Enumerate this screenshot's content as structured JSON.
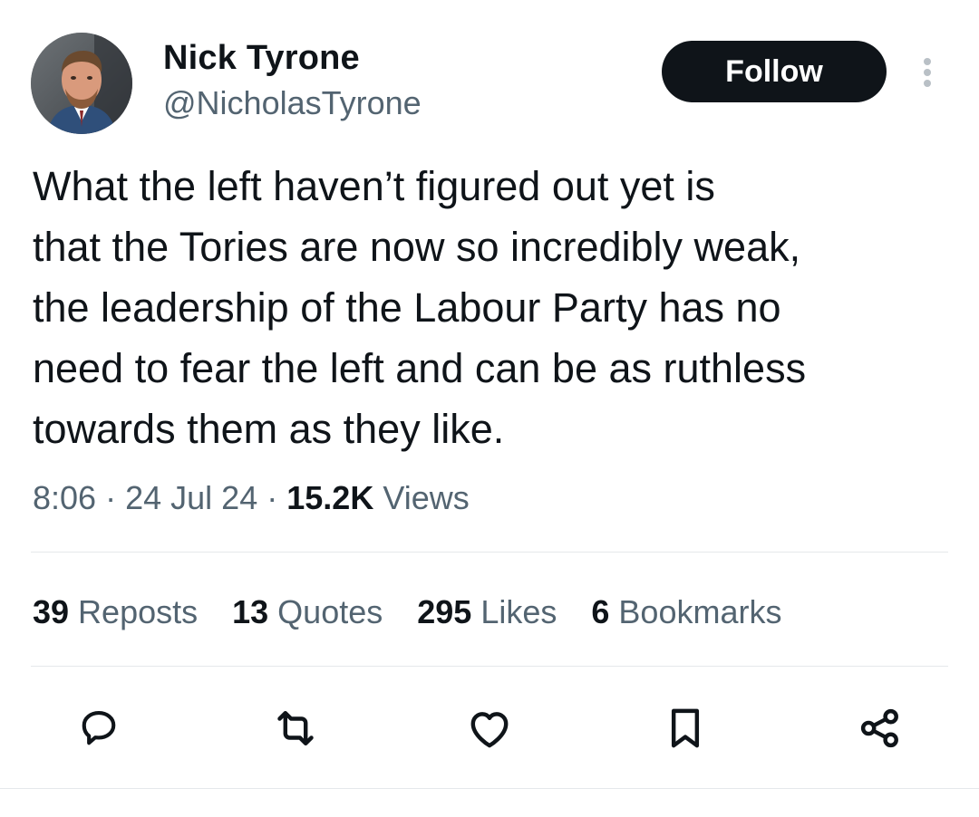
{
  "author": {
    "display_name": "Nick Tyrone",
    "handle": "@NicholasTyrone",
    "avatar_icon": "profile-photo"
  },
  "header": {
    "follow_label": "Follow",
    "more_icon": "more-vertical-icon"
  },
  "tweet": {
    "text": "What the left haven’t figured out yet is\nthat the Tories are now so incredibly weak,\nthe leadership of the Labour Party has no\nneed to fear the left and can be as ruthless\ntowards them as they like."
  },
  "meta": {
    "time": "8:06",
    "separator": "·",
    "date": "24 Jul 24",
    "views_count": "15.2K",
    "views_label": "Views"
  },
  "stats": {
    "reposts_count": "39",
    "reposts_label": "Reposts",
    "quotes_count": "13",
    "quotes_label": "Quotes",
    "likes_count": "295",
    "likes_label": "Likes",
    "bookmarks_count": "6",
    "bookmarks_label": "Bookmarks"
  },
  "actions": [
    "reply-icon",
    "repost-icon",
    "like-icon",
    "bookmark-icon",
    "share-icon"
  ],
  "colors": {
    "text_primary": "#0f1419",
    "text_secondary": "#536471",
    "divider": "#e5e8eb",
    "follow_bg": "#0f1419",
    "follow_text": "#ffffff"
  }
}
